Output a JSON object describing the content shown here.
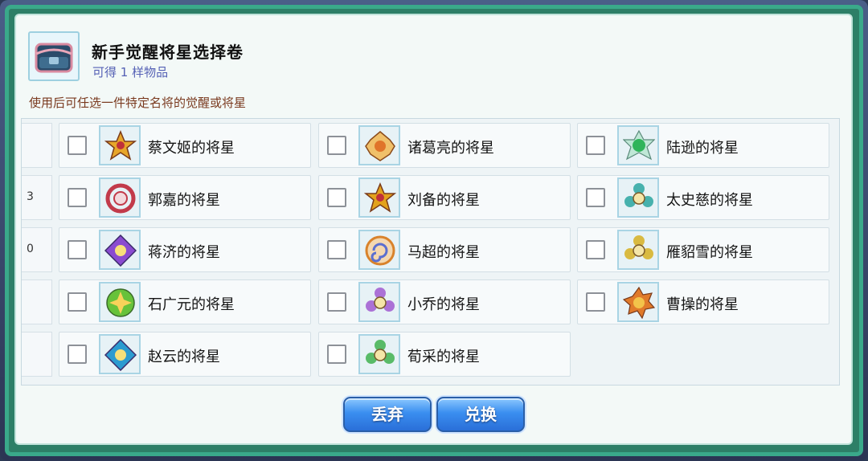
{
  "dialog": {
    "title": "新手觉醒将星选择卷",
    "subtitle": "可得 1 样物品",
    "description": "使用后可任选一件特定名将的觉醒或将星",
    "left_stub_glyphs": [
      "",
      "3",
      "0",
      "",
      ""
    ]
  },
  "items": [
    {
      "label": "蔡文姬的将星",
      "icon": "orange-star-emblem-icon",
      "color": "#e7a62a"
    },
    {
      "label": "诸葛亮的将星",
      "icon": "orange-gem-star-icon",
      "color": "#e0742a"
    },
    {
      "label": "陆逊的将星",
      "icon": "green-orb-emblem-icon",
      "color": "#2fb45a"
    },
    {
      "label": "郭嘉的将星",
      "icon": "red-ring-emblem-icon",
      "color": "#c23a4a"
    },
    {
      "label": "刘备的将星",
      "icon": "gold-star-emblem-icon",
      "color": "#e2a21c"
    },
    {
      "label": "太史慈的将星",
      "icon": "teal-flower-emblem-icon",
      "color": "#2aa6a0"
    },
    {
      "label": "蒋济的将星",
      "icon": "purple-diamond-emblem-icon",
      "color": "#8a4bd0"
    },
    {
      "label": "马超的将星",
      "icon": "swirl-emblem-icon",
      "color": "#d9822b"
    },
    {
      "label": "雁貂雪的将星",
      "icon": "yellow-flower-emblem-icon",
      "color": "#d6b021"
    },
    {
      "label": "石广元的将星",
      "icon": "green-round-emblem-icon",
      "color": "#67c23a"
    },
    {
      "label": "小乔的将星",
      "icon": "purple-flower-emblem-icon",
      "color": "#a05ad0"
    },
    {
      "label": "曹操的将星",
      "icon": "orange-sun-emblem-icon",
      "color": "#e07a2a"
    },
    {
      "label": "赵云的将星",
      "icon": "blue-green-diamond-emblem-icon",
      "color": "#2c9bd0"
    },
    {
      "label": "荀采的将星",
      "icon": "green-flower-emblem-icon",
      "color": "#3fb24f"
    }
  ],
  "buttons": {
    "discard": "丢弃",
    "exchange": "兑换"
  }
}
